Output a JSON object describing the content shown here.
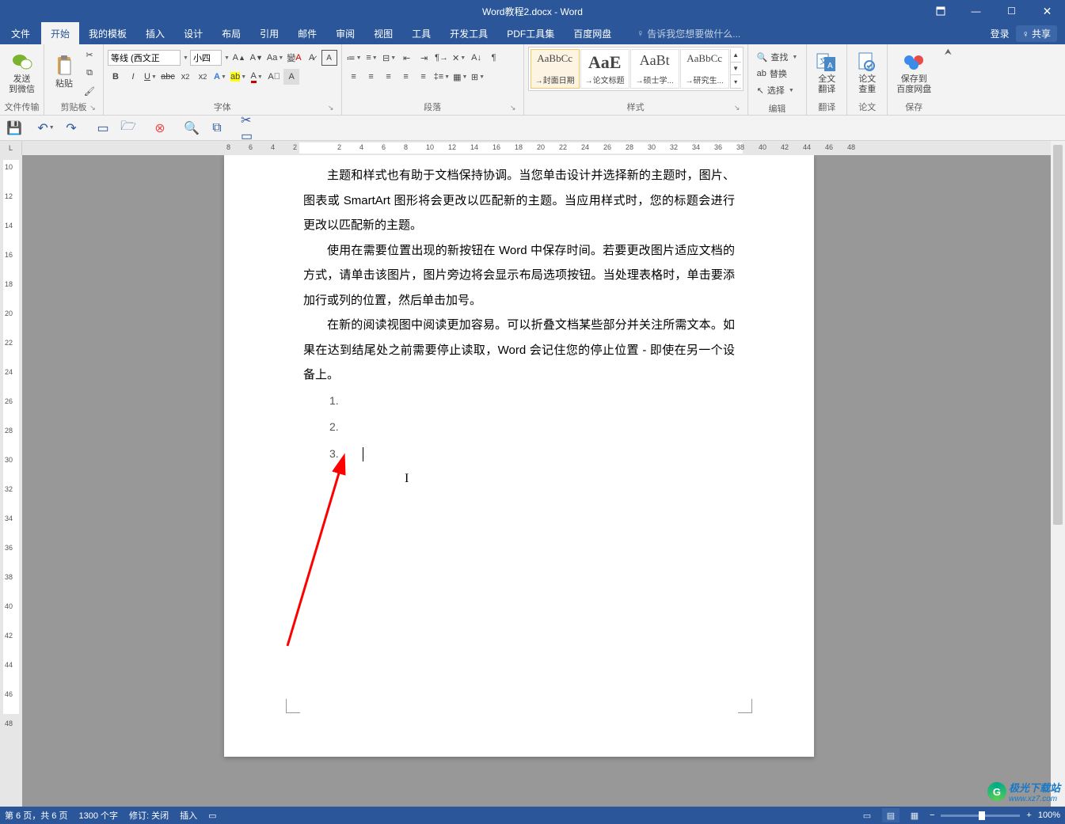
{
  "title": "Word教程2.docx - Word",
  "window_buttons": {
    "overflow": "⋯",
    "min": "—",
    "max": "☐",
    "close": "✕"
  },
  "menubar": {
    "tabs": [
      "文件",
      "开始",
      "我的模板",
      "插入",
      "设计",
      "布局",
      "引用",
      "邮件",
      "审阅",
      "视图",
      "工具",
      "开发工具",
      "PDF工具集",
      "百度网盘"
    ],
    "active_index": 1,
    "tell_me": "告诉我您想要做什么...",
    "login": "登录",
    "share": "共享"
  },
  "ribbon": {
    "groups": {
      "wechat": {
        "label": "文件传输",
        "btn": "发送\n到微信"
      },
      "clipboard": {
        "label": "剪贴板",
        "paste": "粘贴"
      },
      "font": {
        "label": "字体",
        "name": "等线 (西文正",
        "size": "小四"
      },
      "paragraph": {
        "label": "段落"
      },
      "styles": {
        "label": "样式",
        "items": [
          {
            "preview": "AaBbCc",
            "label": "→封面日期",
            "size": "13px"
          },
          {
            "preview": "AaE",
            "label": "→论文标题",
            "size": "22px",
            "bold": true
          },
          {
            "preview": "AaBt",
            "label": "→硕士学...",
            "size": "18px"
          },
          {
            "preview": "AaBbCc",
            "label": "→研究生...",
            "size": "13px"
          }
        ]
      },
      "editing": {
        "label": "编辑",
        "find": "查找",
        "replace": "替换",
        "select": "选择"
      },
      "translate": {
        "label": "翻译",
        "btn": "全文\n翻译"
      },
      "check": {
        "label": "论文",
        "btn": "论文\n查重"
      },
      "save": {
        "label": "保存",
        "btn": "保存到\n百度网盘"
      }
    }
  },
  "qat": {
    "items": [
      "save",
      "undo",
      "redo",
      "",
      "new",
      "open",
      "",
      "baidu",
      "",
      "zoom",
      "copy",
      "",
      "screenshot"
    ]
  },
  "ruler": {
    "corner": "L",
    "hmarks": [
      -8,
      -6,
      -4,
      -2,
      2,
      4,
      6,
      8,
      10,
      12,
      14,
      16,
      18,
      20,
      22,
      24,
      26,
      28,
      30,
      32,
      34,
      36,
      38,
      40,
      42,
      44,
      46,
      48
    ],
    "vmarks": [
      10,
      12,
      14,
      16,
      18,
      20,
      22,
      24,
      26,
      28,
      30,
      32,
      34,
      36,
      38,
      40,
      42,
      44,
      46,
      48
    ]
  },
  "document": {
    "paragraphs": [
      "主题和样式也有助于文档保持协调。当您单击设计并选择新的主题时，图片、图表或 SmartArt 图形将会更改以匹配新的主题。当应用样式时，您的标题会进行更改以匹配新的主题。",
      "使用在需要位置出现的新按钮在 Word 中保存时间。若要更改图片适应文档的方式，请单击该图片，图片旁边将会显示布局选项按钮。当处理表格时，单击要添加行或列的位置，然后单击加号。",
      "在新的阅读视图中阅读更加容易。可以折叠文档某些部分并关注所需文本。如果在达到结尾处之前需要停止读取，Word 会记住您的停止位置 - 即使在另一个设备上。"
    ],
    "list_items": [
      "1.",
      "2.",
      "3."
    ]
  },
  "statusbar": {
    "page": "第 6 页，共 6 页",
    "words": "1300 个字",
    "track": "修订: 关闭",
    "mode": "插入",
    "zoom": "100%"
  },
  "watermark": {
    "brand": "极光下载站",
    "url": "www.xz7.com"
  }
}
